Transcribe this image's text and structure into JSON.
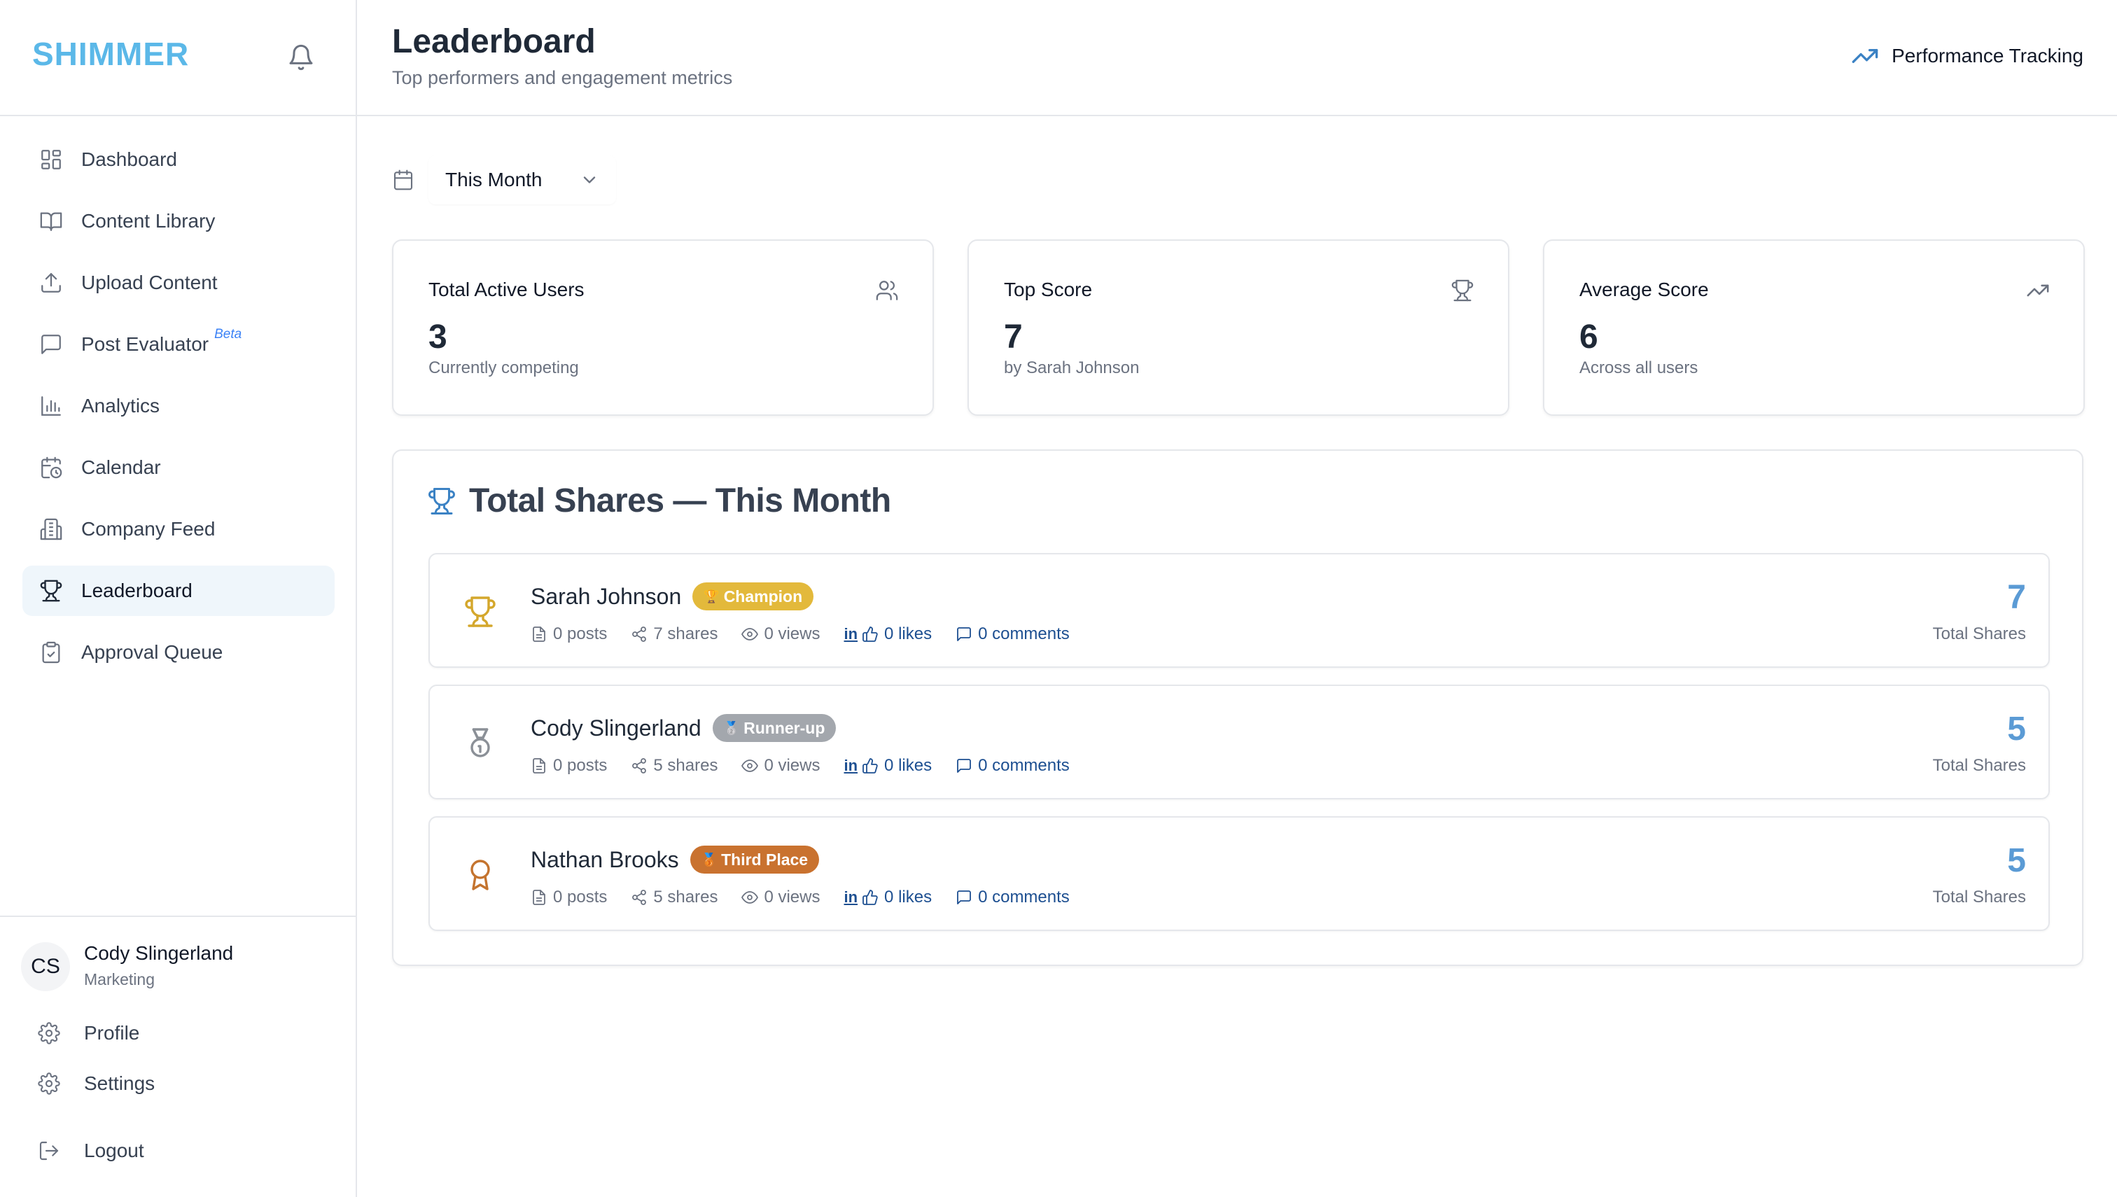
{
  "brand": {
    "name": "SHIMMER"
  },
  "sidebar": {
    "items": [
      {
        "label": "Dashboard",
        "icon": "dashboard-icon"
      },
      {
        "label": "Content Library",
        "icon": "book-open-icon"
      },
      {
        "label": "Upload Content",
        "icon": "upload-icon"
      },
      {
        "label": "Post Evaluator",
        "icon": "message-square-icon",
        "badge": "Beta"
      },
      {
        "label": "Analytics",
        "icon": "bar-chart-icon"
      },
      {
        "label": "Calendar",
        "icon": "calendar-clock-icon"
      },
      {
        "label": "Company Feed",
        "icon": "building-icon"
      },
      {
        "label": "Leaderboard",
        "icon": "trophy-icon",
        "active": true
      },
      {
        "label": "Approval Queue",
        "icon": "clipboard-check-icon"
      }
    ],
    "user": {
      "initials": "CS",
      "name": "Cody Slingerland",
      "role": "Marketing"
    },
    "footer": {
      "profile": "Profile",
      "settings": "Settings",
      "logout": "Logout"
    }
  },
  "header": {
    "title": "Leaderboard",
    "subtitle": "Top performers and engagement metrics",
    "action": "Performance Tracking"
  },
  "filter": {
    "period": "This Month"
  },
  "stats": [
    {
      "title": "Total Active Users",
      "value": "3",
      "note": "Currently competing",
      "icon": "users-icon"
    },
    {
      "title": "Top Score",
      "value": "7",
      "note": "by Sarah Johnson",
      "icon": "trophy-icon"
    },
    {
      "title": "Average Score",
      "value": "6",
      "note": "Across all users",
      "icon": "trending-up-icon"
    }
  ],
  "leaderboard": {
    "title": "Total Shares — This Month",
    "score_label": "Total Shares",
    "rows": [
      {
        "name": "Sarah Johnson",
        "badge": "Champion",
        "badge_color": "#e3b93b",
        "rank_icon": "trophy-icon",
        "rank_color": "#d4a72c",
        "posts": "0 posts",
        "shares": "7 shares",
        "views": "0 views",
        "likes": "0 likes",
        "comments": "0 comments",
        "score": "7"
      },
      {
        "name": "Cody Slingerland",
        "badge": "Runner-up",
        "badge_color": "#a3a7ad",
        "rank_icon": "medal-icon",
        "rank_color": "#8b9097",
        "posts": "0 posts",
        "shares": "5 shares",
        "views": "0 views",
        "likes": "0 likes",
        "comments": "0 comments",
        "score": "5"
      },
      {
        "name": "Nathan Brooks",
        "badge": "Third Place",
        "badge_color": "#c9722f",
        "rank_icon": "award-icon",
        "rank_color": "#c4742f",
        "posts": "0 posts",
        "shares": "5 shares",
        "views": "0 views",
        "likes": "0 likes",
        "comments": "0 comments",
        "score": "5"
      }
    ]
  },
  "colors": {
    "brand": "#5bb8e8",
    "accent": "#5b9bd5",
    "link": "#1d4f91"
  }
}
